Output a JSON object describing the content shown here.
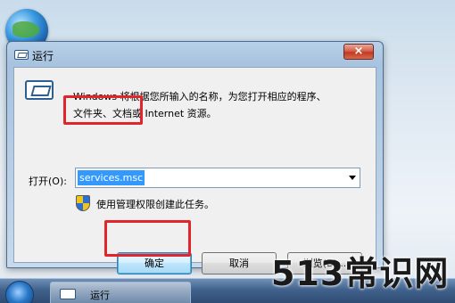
{
  "window": {
    "title": "运行",
    "close_label": "×"
  },
  "dialog": {
    "description_line1": "Windows 将根据您所输入的名称，为您打开相应的程序、",
    "description_line2": "文件夹、文档或 Internet 资源。",
    "open_label": "打开(O):",
    "open_value": "services.msc",
    "admin_note": "使用管理权限创建此任务。"
  },
  "buttons": {
    "ok": "确定",
    "cancel": "取消",
    "browse": "浏览(B)..."
  },
  "taskbar": {
    "task_label": "运行"
  },
  "watermark": "513常识网",
  "colors": {
    "highlight_box": "#e2252b",
    "selection": "#3399ff"
  }
}
